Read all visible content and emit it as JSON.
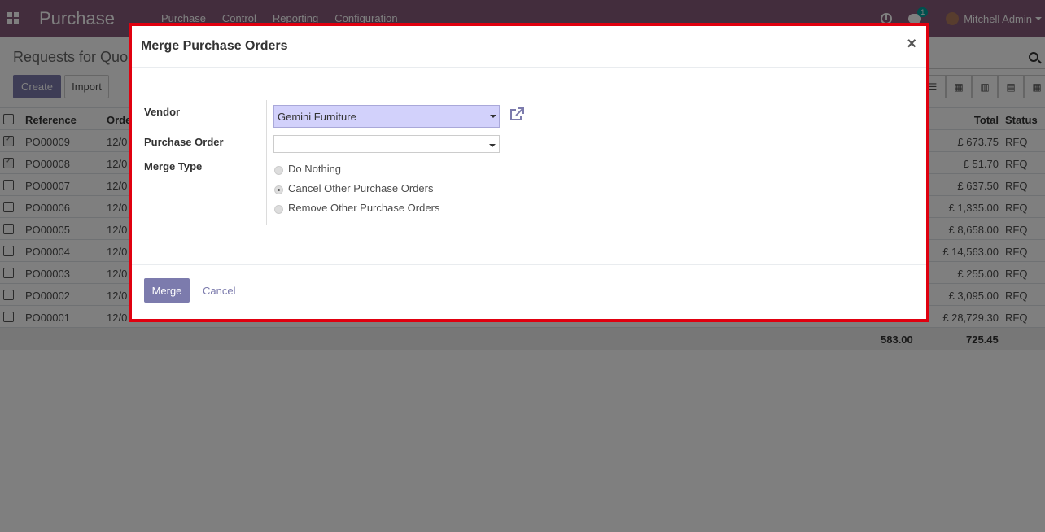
{
  "navbar": {
    "brand": "Purchase",
    "menu": [
      "Purchase",
      "Control",
      "Reporting",
      "Configuration"
    ],
    "chat_count": "1",
    "user": "Mitchell Admin"
  },
  "page": {
    "title": "Requests for Quo",
    "create_label": "Create",
    "import_label": "Import"
  },
  "list": {
    "headers": {
      "reference": "Reference",
      "order": "Orde",
      "total": "Total",
      "status": "Status"
    },
    "rows": [
      {
        "ref": "PO00009",
        "date": "12/0",
        "total": "£ 673.75",
        "status": "RFQ",
        "checked": true
      },
      {
        "ref": "PO00008",
        "date": "12/0",
        "total": "£ 51.70",
        "status": "RFQ",
        "checked": true
      },
      {
        "ref": "PO00007",
        "date": "12/0",
        "total": "£ 637.50",
        "status": "RFQ",
        "checked": false
      },
      {
        "ref": "PO00006",
        "date": "12/0",
        "total": "£ 1,335.00",
        "status": "RFQ",
        "checked": false
      },
      {
        "ref": "PO00005",
        "date": "12/0",
        "total": "£ 8,658.00",
        "status": "RFQ",
        "checked": false
      },
      {
        "ref": "PO00004",
        "date": "12/0",
        "total": "£ 14,563.00",
        "status": "RFQ",
        "checked": false
      },
      {
        "ref": "PO00003",
        "date": "12/0",
        "total": "£ 255.00",
        "status": "RFQ",
        "checked": false
      },
      {
        "ref": "PO00002",
        "date": "12/0",
        "total": "£ 3,095.00",
        "status": "RFQ",
        "checked": false
      },
      {
        "ref": "PO00001",
        "date": "12/0",
        "total": "£ 28,729.30",
        "status": "RFQ",
        "checked": false
      }
    ],
    "footer": {
      "sum1": "583.00",
      "sum2": "725.45"
    }
  },
  "modal": {
    "title": "Merge Purchase Orders",
    "close": "×",
    "vendor_label": "Vendor",
    "vendor_value": "Gemini Furniture",
    "purchase_order_label": "Purchase Order",
    "purchase_order_value": "",
    "merge_type_label": "Merge Type",
    "merge_options": [
      "Do Nothing",
      "Cancel Other Purchase Orders",
      "Remove Other Purchase Orders"
    ],
    "merge_selected": "Cancel Other Purchase Orders",
    "merge_button": "Merge",
    "cancel_button": "Cancel"
  },
  "colors": {
    "brand": "#875a7b",
    "primary_button": "#7c7bad",
    "highlight_border": "#e0000f",
    "vendor_select_bg": "#d2d1fb"
  }
}
